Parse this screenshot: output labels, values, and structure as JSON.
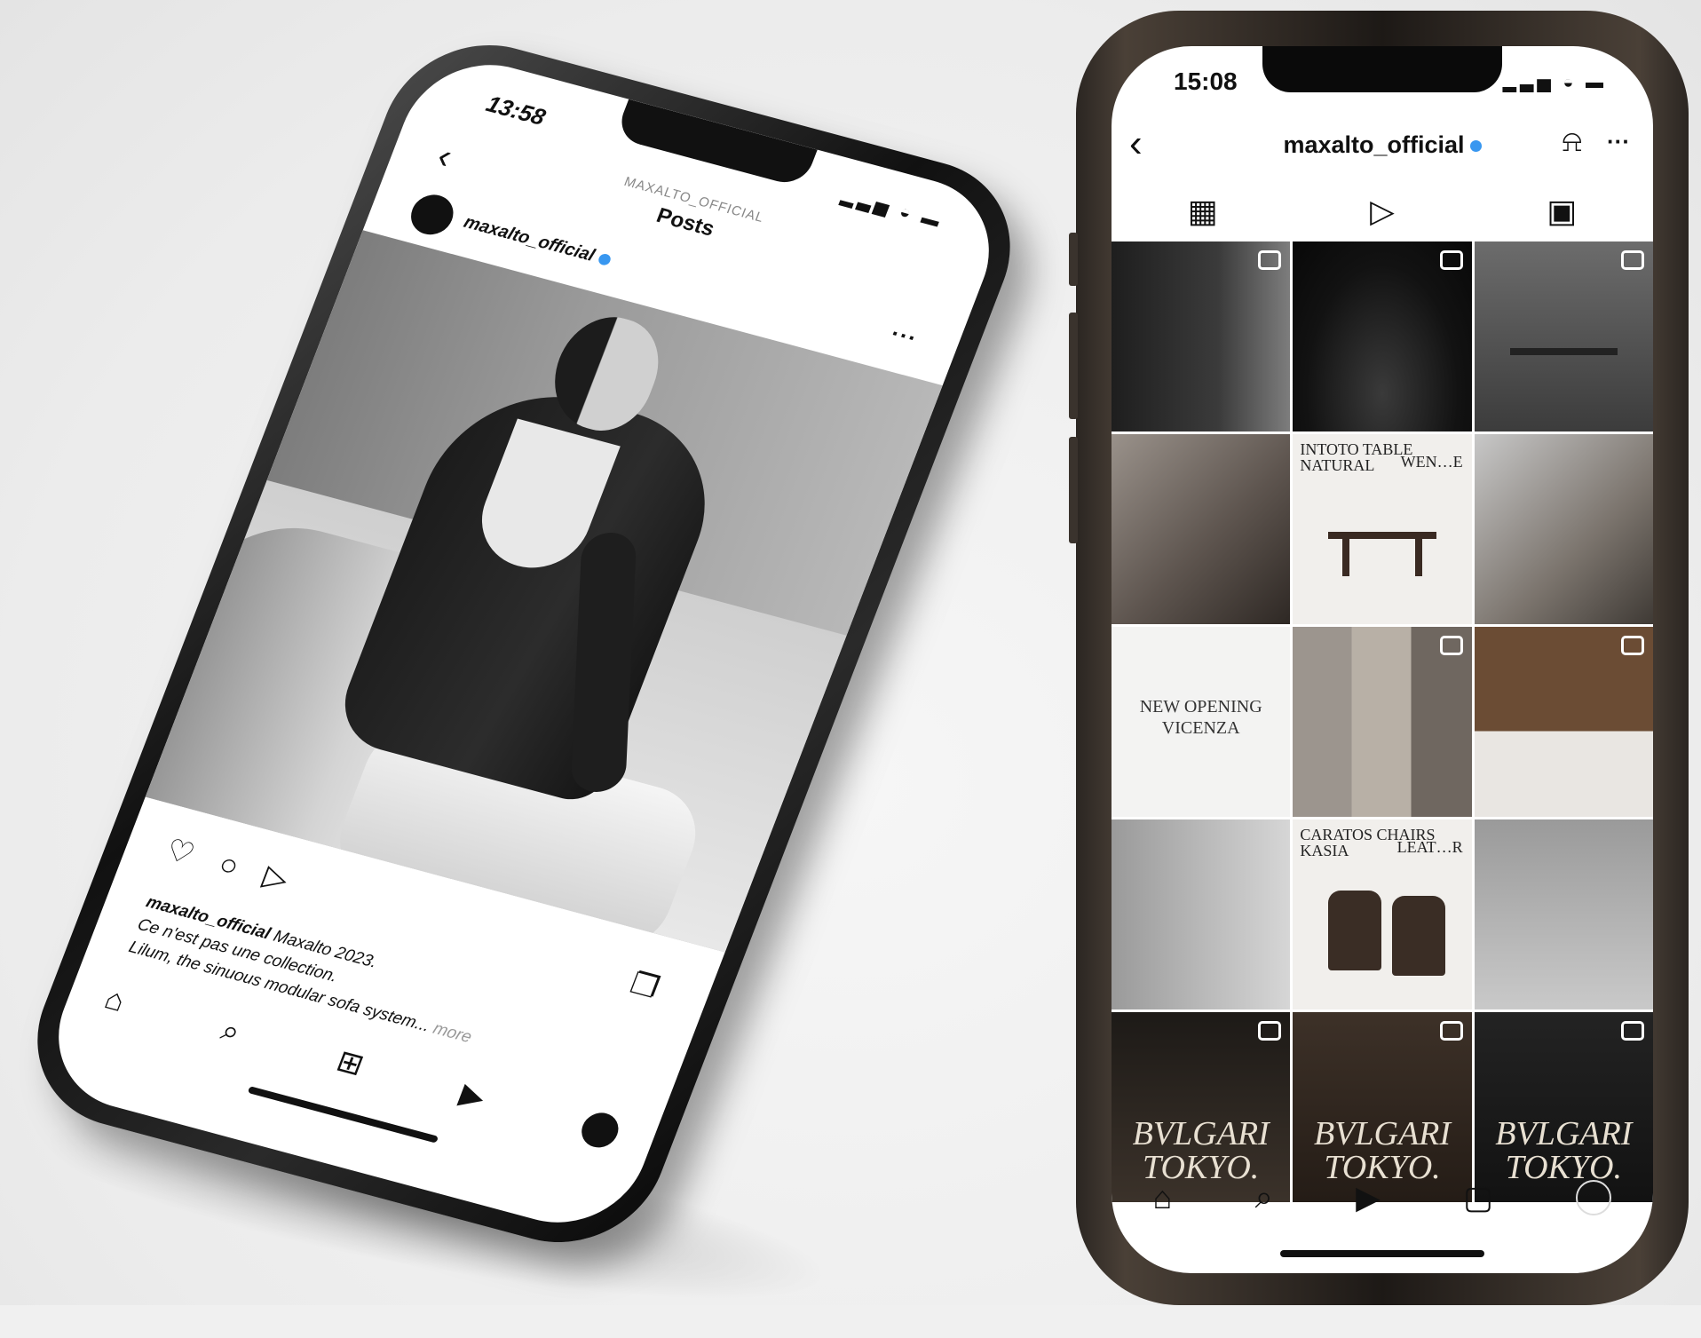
{
  "left_phone": {
    "status_time": "13:58",
    "status_icons": "▂▃▅ ◒ ▬",
    "header_kicker": "MAXALTO_OFFICIAL",
    "header_title": "Posts",
    "back_glyph": "‹",
    "post_username": "maxalto_official",
    "more_glyph": "···",
    "action_icons": {
      "like": "♡",
      "comment": "○",
      "share": "▷",
      "save": "❐"
    },
    "caption": {
      "username": "maxalto_official",
      "line1": "Maxalto 2023.",
      "line2": "Ce n'est pas une collection.",
      "line3": "Lilum, the sinuous modular sofa system...",
      "more": "more"
    },
    "nav_icons": {
      "home": "⌂",
      "search": "⌕",
      "create": "⊞",
      "reels": "▶"
    }
  },
  "right_phone": {
    "status_time": "15:08",
    "status_icons": "▂▃▅ ◒ ▬",
    "back_glyph": "‹",
    "username": "maxalto_official",
    "bell_glyph": "⍾",
    "more_glyph": "···",
    "tabs": {
      "grid": "▦",
      "reels": "▷",
      "tagged": "▣"
    },
    "tiles": {
      "t5_title": "INTOTO TABLE\nNATURAL",
      "t5_sub": "WEN…E",
      "t7_text": "NEW OPENING\nVICENZA",
      "t11_title": "CARATOS CHAIRS\nKASIA",
      "t11_sub": "LEAT…R",
      "bvlgari_1": "BVLGARI\nTOKYO.",
      "bvlgari_2": "BVLGARI\nTOKYO.",
      "bvlgari_3": "BVLGARI\nTOKYO."
    },
    "nav_icons": {
      "home": "⌂",
      "search": "⌕",
      "reels": "▶",
      "shop": "▢"
    }
  }
}
